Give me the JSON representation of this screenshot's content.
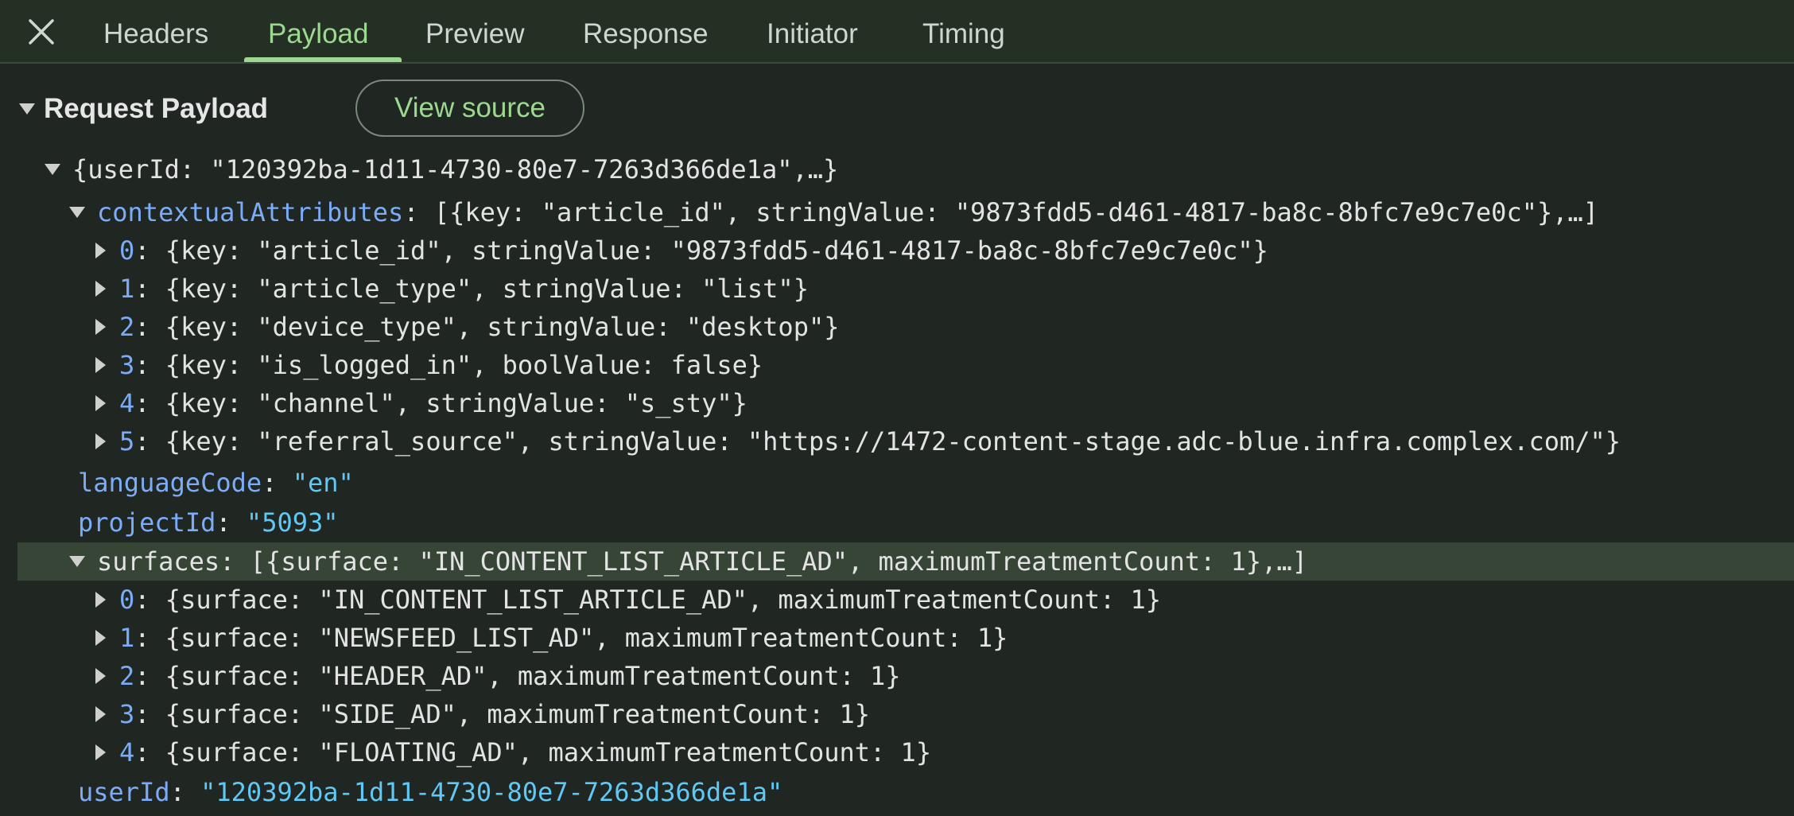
{
  "tabs": {
    "close_icon": "close-icon",
    "items": [
      "Headers",
      "Payload",
      "Preview",
      "Response",
      "Initiator",
      "Timing"
    ],
    "active": "Payload",
    "accent_color": "#9cd88f"
  },
  "payload": {
    "title": "Request Payload",
    "view_source_label": "View source",
    "root_summary": "{userId: \"120392ba-1d11-4730-80e7-7263d366de1a\",…}",
    "contextual_attributes": {
      "key": "contextualAttributes",
      "summary": "[{key: \"article_id\", stringValue: \"9873fdd5-d461-4817-ba8c-8bfc7e9c7e0c\"},…]",
      "items": [
        {
          "index": "0",
          "value": "{key: \"article_id\", stringValue: \"9873fdd5-d461-4817-ba8c-8bfc7e9c7e0c\"}"
        },
        {
          "index": "1",
          "value": "{key: \"article_type\", stringValue: \"list\"}"
        },
        {
          "index": "2",
          "value": "{key: \"device_type\", stringValue: \"desktop\"}"
        },
        {
          "index": "3",
          "value": "{key: \"is_logged_in\", boolValue: false}"
        },
        {
          "index": "4",
          "value": "{key: \"channel\", stringValue: \"s_sty\"}"
        },
        {
          "index": "5",
          "value": "{key: \"referral_source\", stringValue: \"https://1472-content-stage.adc-blue.infra.complex.com/\"}"
        }
      ]
    },
    "language_code": {
      "key": "languageCode",
      "value": "\"en\""
    },
    "project_id": {
      "key": "projectId",
      "value": "\"5093\""
    },
    "surfaces": {
      "key": "surfaces",
      "summary": "[{surface: \"IN_CONTENT_LIST_ARTICLE_AD\", maximumTreatmentCount: 1},…]",
      "items": [
        {
          "index": "0",
          "value": "{surface: \"IN_CONTENT_LIST_ARTICLE_AD\", maximumTreatmentCount: 1}"
        },
        {
          "index": "1",
          "value": "{surface: \"NEWSFEED_LIST_AD\", maximumTreatmentCount: 1}"
        },
        {
          "index": "2",
          "value": "{surface: \"HEADER_AD\", maximumTreatmentCount: 1}"
        },
        {
          "index": "3",
          "value": "{surface: \"SIDE_AD\", maximumTreatmentCount: 1}"
        },
        {
          "index": "4",
          "value": "{surface: \"FLOATING_AD\", maximumTreatmentCount: 1}"
        }
      ]
    },
    "user_id": {
      "key": "userId",
      "value": "\"120392ba-1d11-4730-80e7-7263d366de1a\""
    }
  }
}
